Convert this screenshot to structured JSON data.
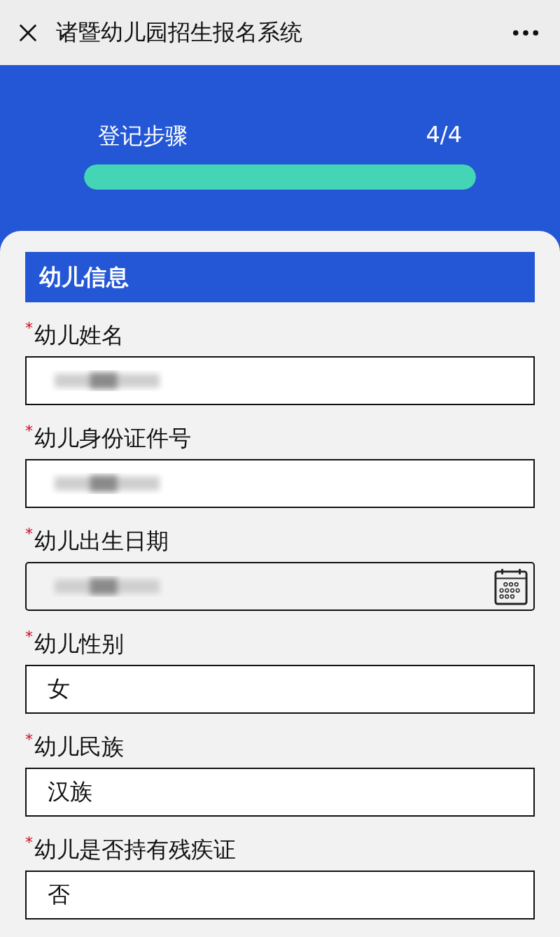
{
  "window": {
    "title": "诸暨幼儿园招生报名系统"
  },
  "progress": {
    "label": "登记步骤",
    "reading": "4/4",
    "level": 1
  },
  "section": {
    "title": "幼儿信息",
    "fields": [
      {
        "mark": "*",
        "label": "幼儿姓名",
        "kind": "text",
        "disabled": false
      },
      {
        "mark": "*",
        "label": "幼儿身份证件号",
        "kind": "text",
        "disabled": false
      },
      {
        "mark": "*",
        "label": "幼儿出生日期",
        "kind": "date",
        "disabled": true
      },
      {
        "mark": "*",
        "label": "幼儿性别",
        "kind": "text",
        "value": "女",
        "disabled": false
      },
      {
        "mark": "*",
        "label": "幼儿民族",
        "kind": "text",
        "value": "汉族",
        "disabled": false
      },
      {
        "mark": "*",
        "label": "幼儿是否持有残疾证",
        "kind": "text",
        "value": "否",
        "disabled": false
      }
    ]
  }
}
